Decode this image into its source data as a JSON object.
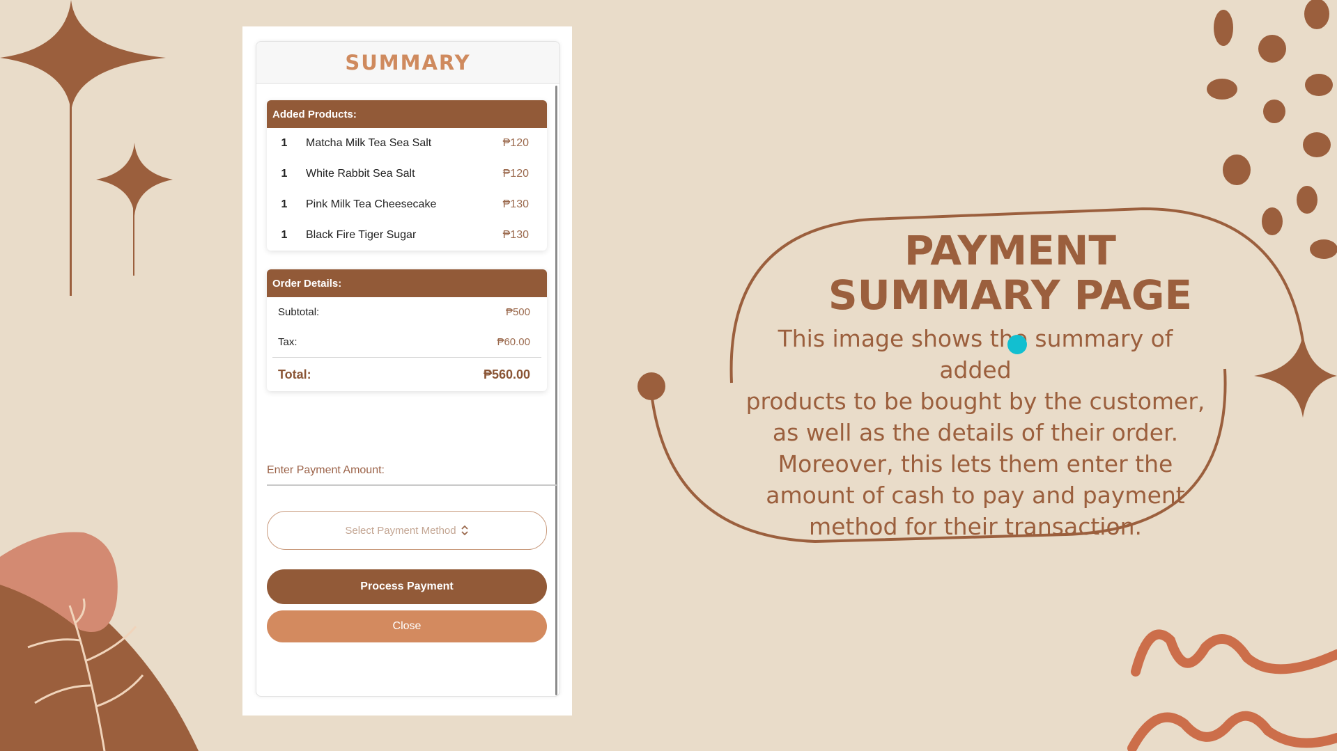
{
  "colors": {
    "background": "#e9dcc9",
    "brand_brown": "#925a38",
    "accent_orange": "#d38a5f",
    "title_text": "#9b5f3d",
    "cursor": "#12bfd0"
  },
  "modal": {
    "title": "SUMMARY",
    "products_header": "Added Products:",
    "products": [
      {
        "qty": "1",
        "name": "Matcha Milk Tea Sea Salt",
        "price": "₱120"
      },
      {
        "qty": "1",
        "name": "White Rabbit Sea Salt",
        "price": "₱120"
      },
      {
        "qty": "1",
        "name": "Pink Milk Tea Cheesecake",
        "price": "₱130"
      },
      {
        "qty": "1",
        "name": "Black Fire Tiger Sugar",
        "price": "₱130"
      }
    ],
    "order_header": "Order Details:",
    "subtotal_label": "Subtotal:",
    "subtotal_value": "₱500",
    "tax_label": "Tax:",
    "tax_value": "₱60.00",
    "total_label": "Total:",
    "total_value": "₱560.00",
    "payment_amount_placeholder": "Enter Payment Amount:",
    "payment_method_select": "Select Payment Method",
    "process_button": "Process Payment",
    "close_button": "Close"
  },
  "info": {
    "title_line1": "PAYMENT",
    "title_line2": "SUMMARY PAGE",
    "description_lines": [
      "This image shows the summary of added",
      "products to be bought by the customer,",
      "as well as the details of their order.",
      "Moreover, this lets them enter the",
      "amount of cash to pay and payment",
      "method for their transaction."
    ]
  }
}
